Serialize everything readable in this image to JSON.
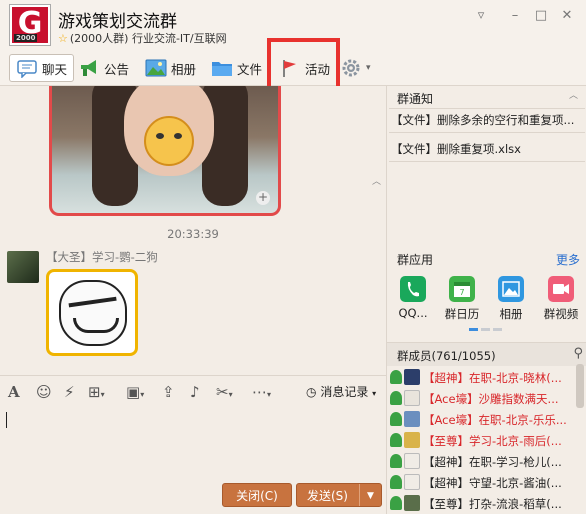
{
  "window": {
    "group_name": "游戏策划交流群",
    "group_meta": "(2000人群) 行业交流-IT/互联网",
    "logo_letter": "G",
    "logo_year": "2000"
  },
  "toolbar": {
    "tabs": [
      {
        "label": "聊天",
        "icon": "chat-bubble-icon",
        "active": true
      },
      {
        "label": "公告",
        "icon": "megaphone-icon"
      },
      {
        "label": "相册",
        "icon": "photo-album-icon"
      },
      {
        "label": "文件",
        "icon": "folder-icon"
      },
      {
        "label": "活动",
        "icon": "flag-icon",
        "highlighted": true
      }
    ],
    "settings_icon": "gear-icon"
  },
  "chat": {
    "timestamp": "20:33:39",
    "message_sender": "【大圣】学习-鹦-二狗"
  },
  "input_toolbar": {
    "history_label": "消息记录"
  },
  "buttons": {
    "close_label": "关闭(C)",
    "send_label": "发送(S)"
  },
  "notices": {
    "title": "群通知",
    "items": [
      "【文件】删除多余的空行和重复项...",
      "【文件】删除重复项.xlsx"
    ]
  },
  "apps": {
    "title": "群应用",
    "more": "更多",
    "items": [
      {
        "label": "QQ...",
        "color": "#1aa85b",
        "icon": "phone-icon"
      },
      {
        "label": "群日历",
        "color": "#3fb24a",
        "icon": "calendar-icon"
      },
      {
        "label": "相册",
        "color": "#2f97e0",
        "icon": "picture-icon"
      },
      {
        "label": "群视频",
        "color": "#f05d78",
        "icon": "video-icon"
      }
    ]
  },
  "members": {
    "title": "群成员(761/1055)",
    "items": [
      {
        "name": "【超神】在职-北京-晓林(...",
        "color": "#d8262a"
      },
      {
        "name": "【Ace壕】沙雕指数满天...",
        "color": "#d8262a"
      },
      {
        "name": "【Ace壕】在职-北京-乐乐...",
        "color": "#d8262a"
      },
      {
        "name": "【至尊】学习-北京-雨后(...",
        "color": "#d8262a"
      },
      {
        "name": "【超神】在职-学习-枪儿(...",
        "color": "#222222"
      },
      {
        "name": "【超神】守望-北京-酱油(...",
        "color": "#222222"
      },
      {
        "name": "【至尊】打杂-流浪-稻草(...",
        "color": "#222222"
      }
    ]
  }
}
